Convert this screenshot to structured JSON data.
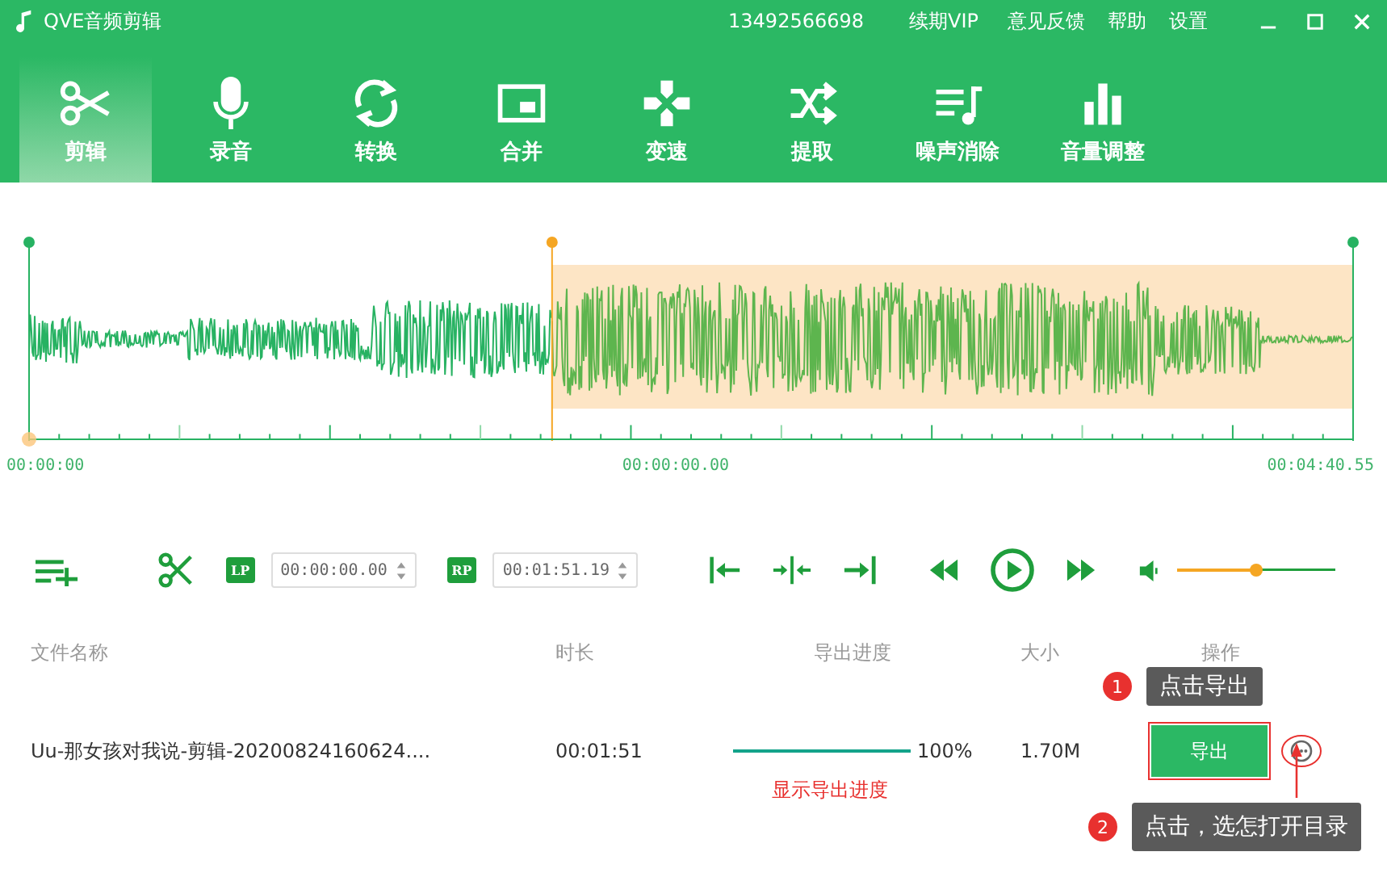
{
  "window": {
    "title": "QVE音频剪辑",
    "account": "13492566698",
    "links": [
      "续期VIP",
      "意见反馈",
      "帮助",
      "设置"
    ]
  },
  "tabs": [
    {
      "label": "剪辑",
      "selected": true
    },
    {
      "label": "录音",
      "selected": false
    },
    {
      "label": "转换",
      "selected": false
    },
    {
      "label": "合并",
      "selected": false
    },
    {
      "label": "变速",
      "selected": false
    },
    {
      "label": "提取",
      "selected": false
    },
    {
      "label": "噪声消除",
      "selected": false
    },
    {
      "label": "音量调整",
      "selected": false
    }
  ],
  "timeline": {
    "start": "00:00:00",
    "current": "00:00:00.00",
    "end": "00:04:40.55"
  },
  "controls": {
    "lp_label": "LP",
    "lp_time": "00:00:00.00",
    "rp_label": "RP",
    "rp_time": "00:01:51.19",
    "volume": {
      "level": 0.5
    }
  },
  "table": {
    "columns": [
      "文件名称",
      "时长",
      "导出进度",
      "大小",
      "操作"
    ],
    "rows": [
      {
        "name": "Uu-那女孩对我说-剪辑-20200824160624....",
        "duration": "00:01:51",
        "progress": {
          "level": 1
        },
        "percent": "100%",
        "size": "1.70M",
        "action": "导出"
      }
    ]
  },
  "annotations": {
    "progress_note": "显示导出进度",
    "callouts": [
      {
        "number": "1",
        "text": "点击导出"
      },
      {
        "number": "2",
        "text": "点击，选怎打开目录"
      }
    ]
  }
}
